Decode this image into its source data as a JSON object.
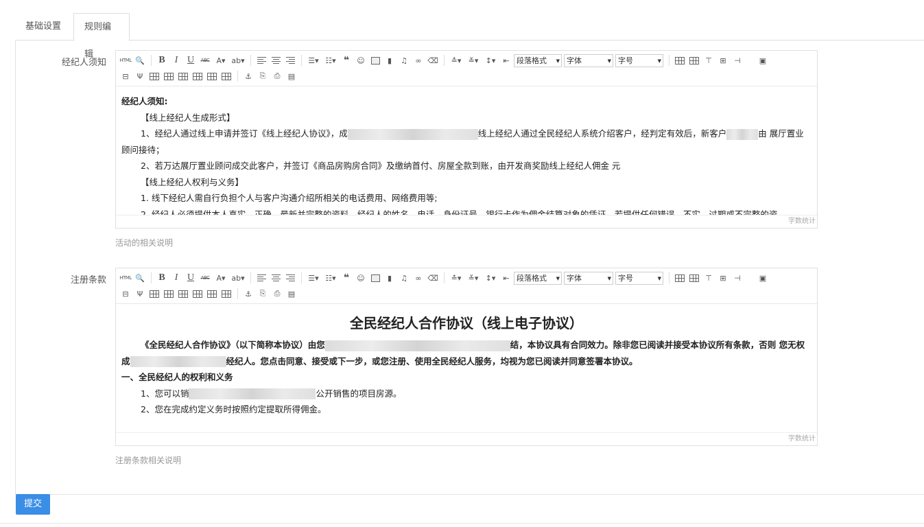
{
  "tabs": [
    {
      "label": "基础设置",
      "active": false
    },
    {
      "label": "规则编辑",
      "active": true
    }
  ],
  "editor_toolbar": {
    "html_label": "HTML",
    "paragraph_select": "段落格式",
    "font_select": "字体",
    "size_select": "字号"
  },
  "field1": {
    "label": "经纪人须知",
    "help": "活动的相关说明",
    "word_count_label": "字数统计",
    "content": {
      "heading": "经纪人须知:",
      "s1": "【线上经纪人生成形式】",
      "p1a": "1、经纪人通过线上申请并签订《线上经纪人协议》，成",
      "p1b": "线上经纪人通过全民经纪人系统介绍客户，经判定有效后，新客户",
      "p1c": "由",
      "p1d": "展厅置业顾问接待；",
      "p2": "2、若万达展厅置业顾问成交此客户，并签订《商品房购房合同》及缴纳首付、房屋全款到账，由开发商奖励线上经纪人佣金    元",
      "s2": "【线上经纪人权利与义务】",
      "p3": "1. 线下经纪人需自行负担个人与客户沟通介绍所相关的电话费用、网络费用等;",
      "p4": "2. 经纪人必须提供本人真实、正确、最新并完整的资料，经纪人的姓名、电话、身份证号、银行卡作为佣金结算对象的凭证，若提供任何错误、不实、过期或不完整的资"
    }
  },
  "field2": {
    "label": "注册条款",
    "help": "注册条款相关说明",
    "word_count_label": "字数统计",
    "content": {
      "title": "全民经纪人合作协议（线上电子协议）",
      "p1a": "《全民经纪人合作协议》（以下简称本协议）由您",
      "p1b": "结，本协议具有合同效力。除非您已阅读并接受本协议所有条款，否则",
      "p1c": "您无权成",
      "p1d": "经纪人。您点击同意、接受或下一步，或您注册、使用全民经纪人服务，均视为您已阅读并同意签署本协议。",
      "s1": "一、全民经纪人的权利和义务",
      "i1a": "1、您可以销",
      "i1b": "公开销售的项目房源。",
      "i2": "2、您在完成约定义务时按照约定提取所得佣金。"
    }
  },
  "submit_label": "提交"
}
